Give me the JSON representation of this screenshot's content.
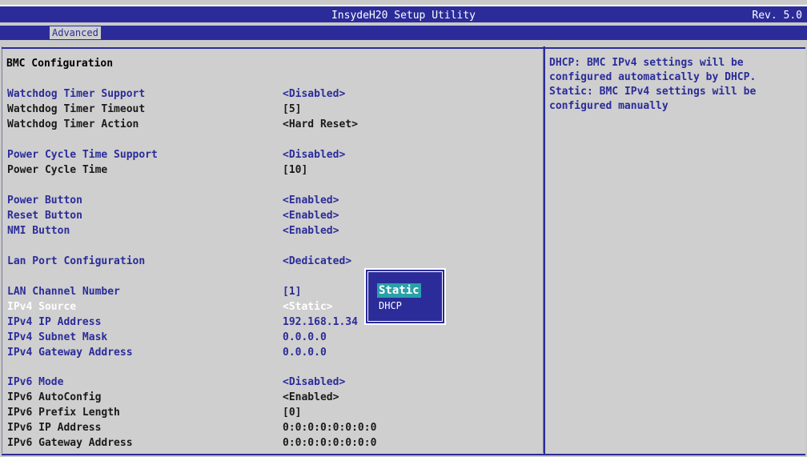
{
  "header": {
    "title": "InsydeH20 Setup Utility",
    "revision": "Rev. 5.0"
  },
  "menu": {
    "active_tab": "Advanced"
  },
  "page_title": "BMC Configuration",
  "items": [
    {
      "label": "Watchdog Timer Support",
      "value": "<Disabled>",
      "color": "blue"
    },
    {
      "label": "Watchdog Timer Timeout",
      "value": "[5]",
      "color": "black"
    },
    {
      "label": "Watchdog Timer Action",
      "value": "<Hard Reset>",
      "color": "black"
    },
    {
      "label": "Power Cycle Time Support",
      "value": "<Disabled>",
      "color": "blue"
    },
    {
      "label": "Power Cycle Time",
      "value": "[10]",
      "color": "black"
    },
    {
      "label": "Power Button",
      "value": "<Enabled>",
      "color": "blue"
    },
    {
      "label": "Reset Button",
      "value": "<Enabled>",
      "color": "blue"
    },
    {
      "label": "NMI Button",
      "value": "<Enabled>",
      "color": "blue"
    },
    {
      "label": "Lan Port Configuration",
      "value": "<Dedicated>",
      "color": "blue"
    },
    {
      "label": "LAN Channel Number",
      "value": "[1]",
      "color": "blue"
    },
    {
      "label": "IPv4 Source",
      "value": "<Static>",
      "color": "white"
    },
    {
      "label": "IPv4 IP Address",
      "value": "192.168.1.34",
      "color": "blue"
    },
    {
      "label": "IPv4 Subnet Mask",
      "value": "0.0.0.0",
      "color": "blue"
    },
    {
      "label": "IPv4 Gateway Address",
      "value": "0.0.0.0",
      "color": "blue"
    },
    {
      "label": "IPv6 Mode",
      "value": "<Disabled>",
      "color": "blue"
    },
    {
      "label": "IPv6 AutoConfig",
      "value": "<Enabled>",
      "color": "black"
    },
    {
      "label": "IPv6 Prefix Length",
      "value": "[0]",
      "color": "black"
    },
    {
      "label": "IPv6 IP Address",
      "value": "0:0:0:0:0:0:0:0",
      "color": "black"
    },
    {
      "label": "IPv6 Gateway Address",
      "value": "0:0:0:0:0:0:0:0",
      "color": "black"
    }
  ],
  "help": {
    "text": "DHCP: BMC IPv4 settings will be\nconfigured automatically by DHCP.\nStatic: BMC IPv4 settings will be\nconfigured manually"
  },
  "popup": {
    "options": [
      "Static",
      "DHCP"
    ],
    "selected": "Static"
  },
  "colors": {
    "bios_blue": "#2b2c99",
    "panel_gray": "#cfcfcf",
    "highlight_teal": "#2aa1a8"
  }
}
